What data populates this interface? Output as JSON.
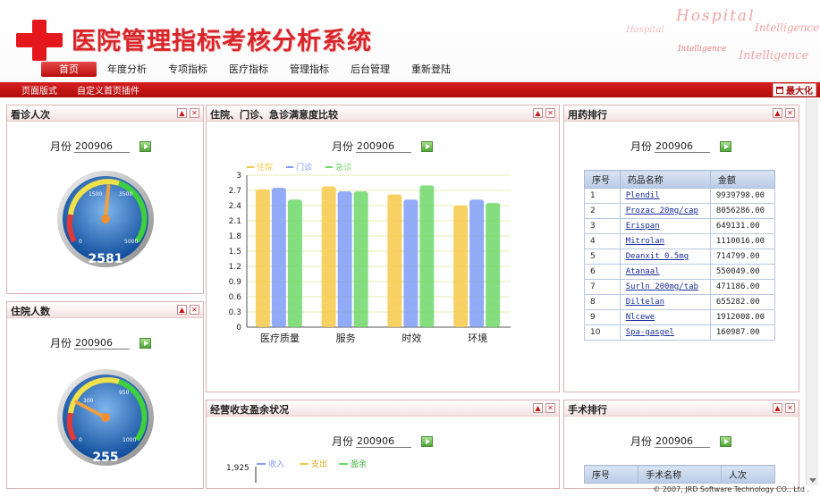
{
  "header": {
    "title": "医院管理指标考核分析系统",
    "deco": [
      "Hospital",
      "Intelligence",
      "Intelligence",
      "Intelligence",
      "Hospital"
    ],
    "nav": [
      "首页",
      "年度分析",
      "专项指标",
      "医疗指标",
      "管理指标",
      "后台管理",
      "重新登陆"
    ]
  },
  "subbar": {
    "items": [
      "页面版式",
      "自定义首页插件"
    ],
    "maximize": "最大化"
  },
  "panels": {
    "visits": {
      "title": "看诊人次",
      "month_label": "月份",
      "month_value": "200906",
      "gauge_value": "2581",
      "ticks": [
        "0",
        "1500",
        "3500",
        "5000"
      ],
      "needle_fraction": 0.52
    },
    "inpatients": {
      "title": "住院人数",
      "month_label": "月份",
      "month_value": "200906",
      "gauge_value": "255",
      "ticks": [
        "0",
        "300",
        "950",
        "1000"
      ],
      "needle_fraction": 0.26
    },
    "satisfaction": {
      "title": "住院、门诊、急诊满意度比较",
      "month_label": "月份",
      "month_value": "200906"
    },
    "drug_rank": {
      "title": "用药排行",
      "month_label": "月份",
      "month_value": "200906",
      "columns": [
        "序号",
        "药品名称",
        "金额"
      ],
      "rows": [
        [
          "1",
          "Plendil",
          "9939798.00"
        ],
        [
          "2",
          "Prozac 20mg/cap",
          "8056286.00"
        ],
        [
          "3",
          "Erispan",
          "649131.00"
        ],
        [
          "4",
          "Mitrolan",
          "1110016.00"
        ],
        [
          "5",
          "Deanxit 0.5mg",
          "714799.00"
        ],
        [
          "6",
          "Atanaal",
          "550049.00"
        ],
        [
          "7",
          "Surln 200mg/tab",
          "471186.00"
        ],
        [
          "8",
          "Diltelan",
          "655282.00"
        ],
        [
          "9",
          "Nlcewe",
          "1912008.00"
        ],
        [
          "10",
          "Spa-gasgel",
          "160987.00"
        ]
      ]
    },
    "finance": {
      "title": "经营收支盈余状况",
      "month_label": "月份",
      "month_value": "200906",
      "legend": [
        "收入",
        "支出",
        "盈余"
      ],
      "y_top": "1,925"
    },
    "surgery_rank": {
      "title": "手术排行",
      "month_label": "月份",
      "month_value": "200906",
      "columns": [
        "序号",
        "手术名称",
        "人次"
      ]
    }
  },
  "footer": {
    "copyright": "© 2007, JRD Software Technology CO., Ltd ."
  },
  "colors": {
    "brand_red": "#d8262a",
    "series": [
      "#f7c94a",
      "#7f9cf5",
      "#6fd86a"
    ]
  },
  "chart_data": {
    "type": "bar",
    "categories": [
      "医疗质量",
      "服务",
      "时效",
      "环境"
    ],
    "series": [
      {
        "name": "住院",
        "values": [
          2.72,
          2.78,
          2.62,
          2.4
        ]
      },
      {
        "name": "门诊",
        "values": [
          2.75,
          2.68,
          2.52,
          2.52
        ]
      },
      {
        "name": "急诊",
        "values": [
          2.52,
          2.68,
          2.8,
          2.45
        ]
      }
    ],
    "ylim": [
      0,
      3
    ],
    "yticks": [
      "0",
      "0.3",
      "0.6",
      "0.9",
      "1.2",
      "1.5",
      "1.8",
      "2.1",
      "2.4",
      "2.7",
      "3"
    ],
    "grid": true,
    "legend": "top-left"
  }
}
